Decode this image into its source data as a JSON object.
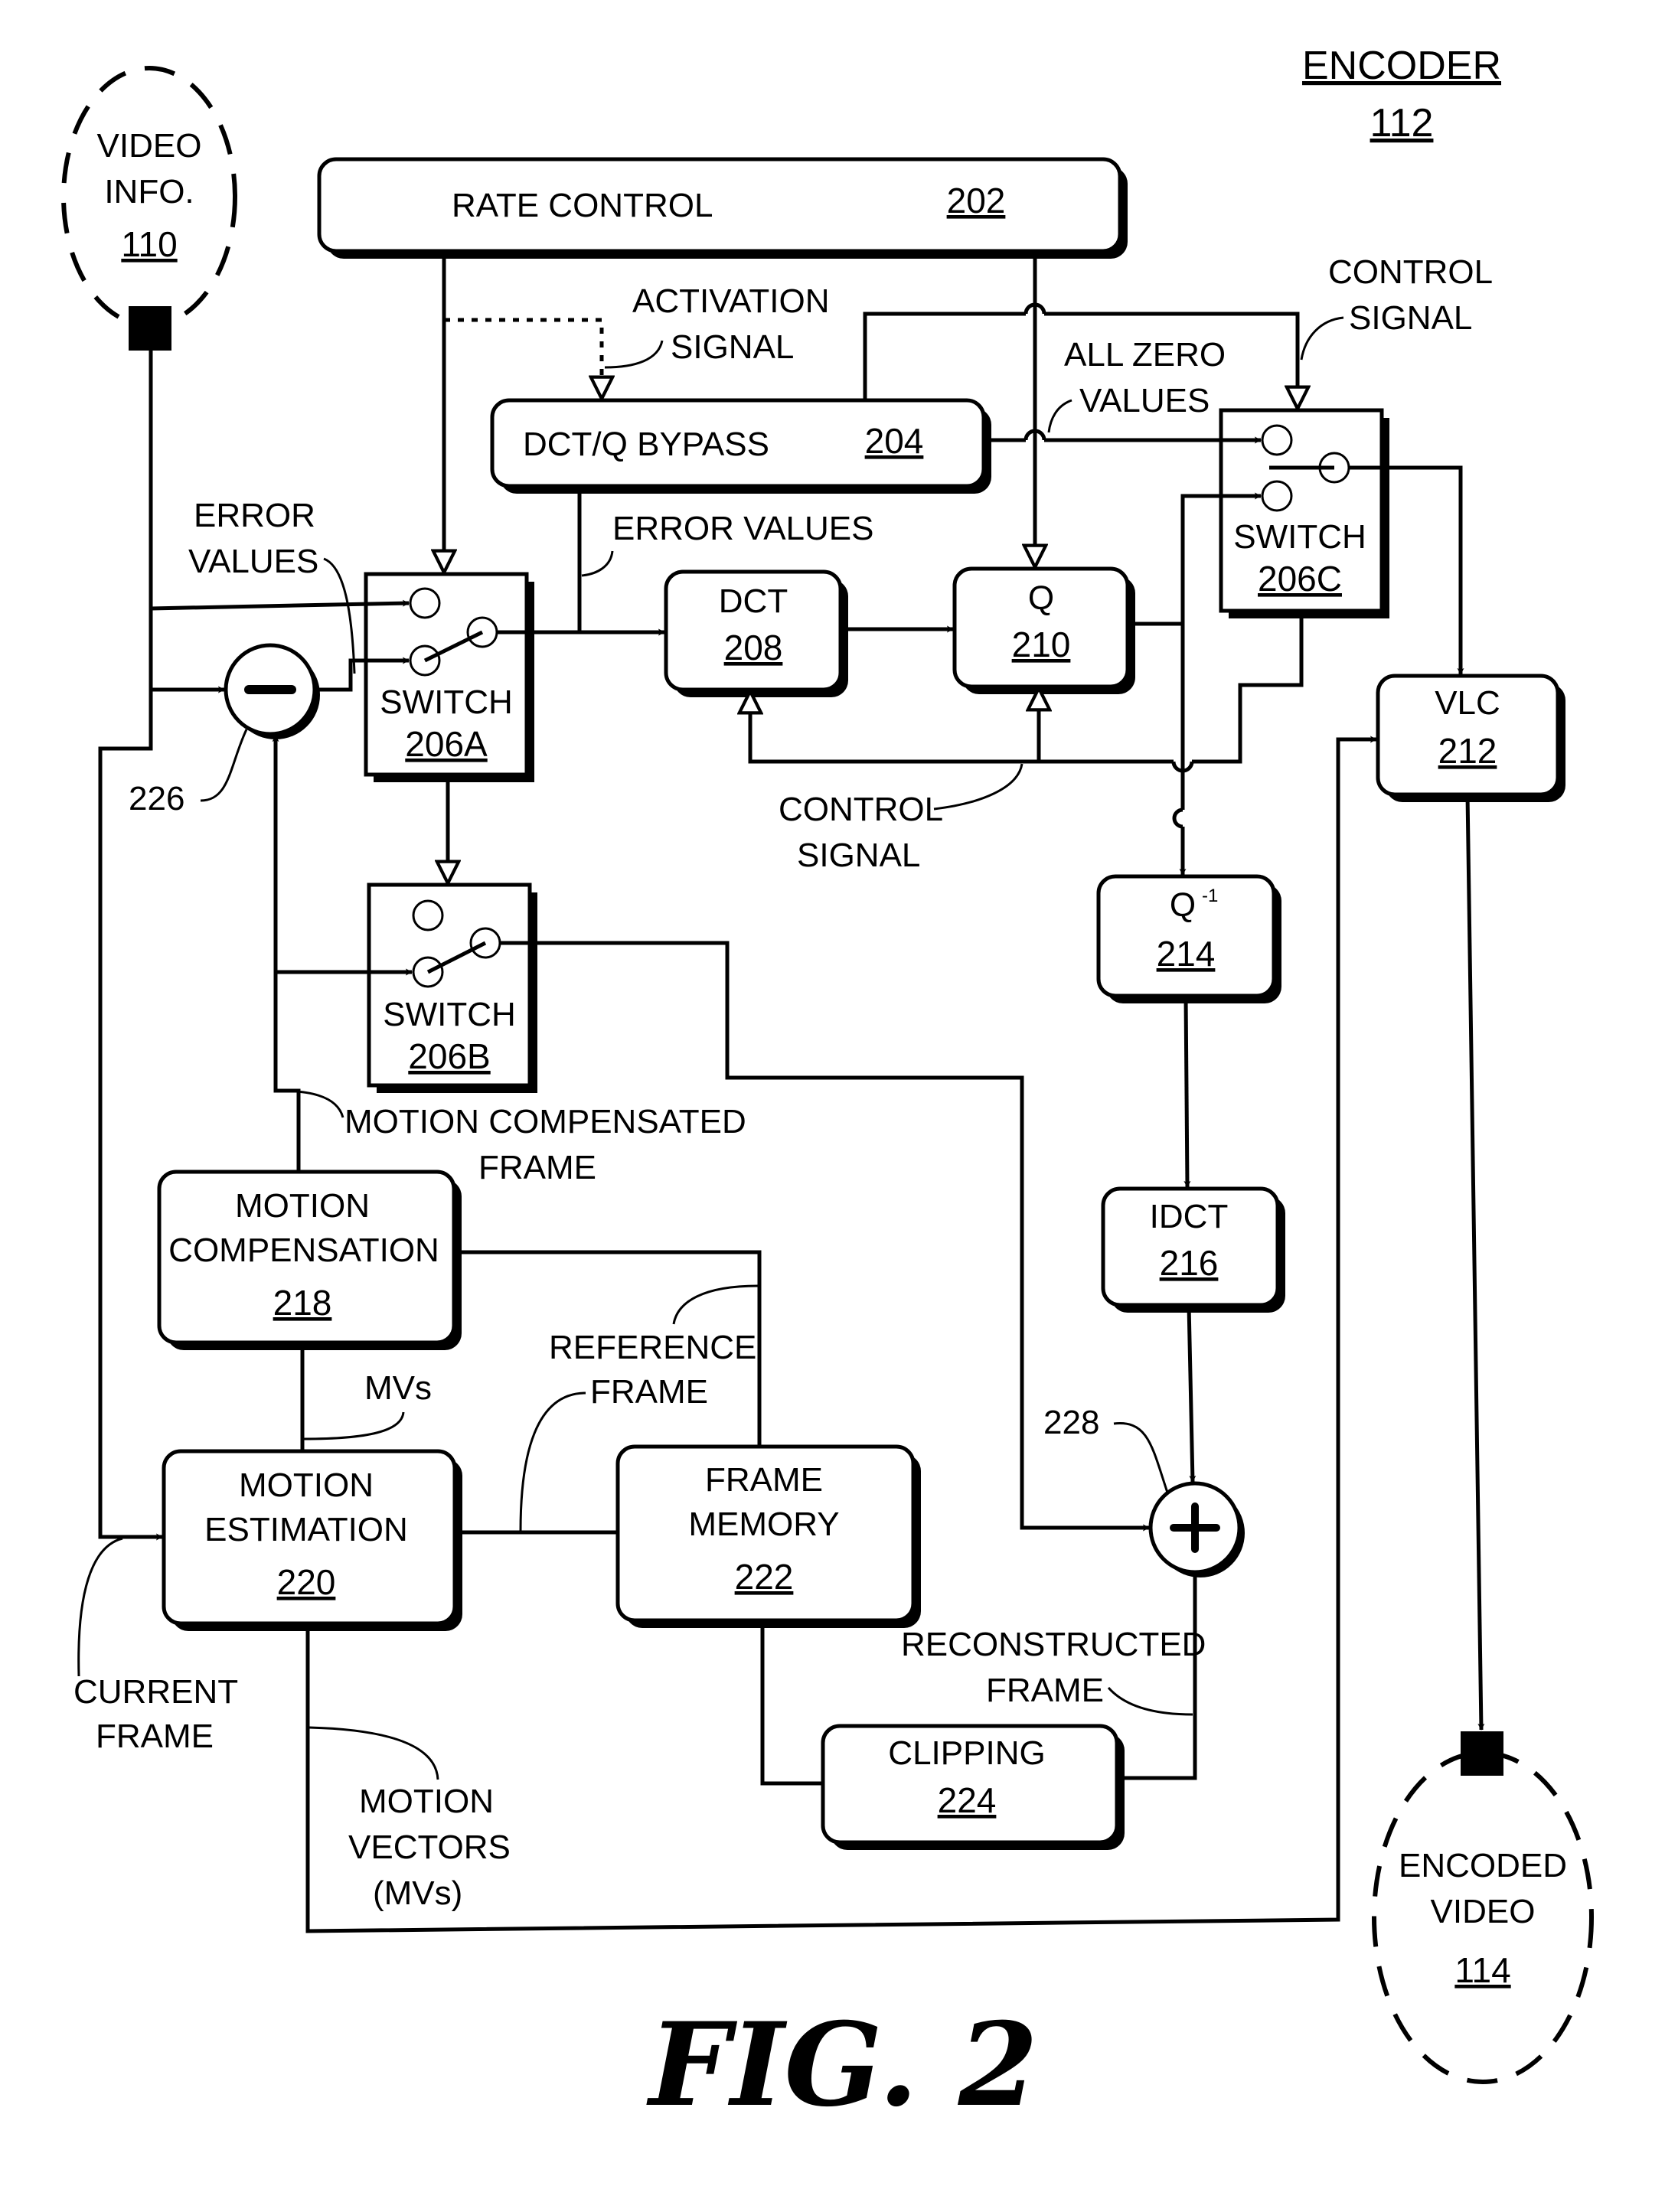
{
  "figure": {
    "title": "ENCODER",
    "title_number": "112",
    "caption": "FIG. 2"
  },
  "terminals": {
    "input": {
      "line1": "VIDEO",
      "line2": "INFO.",
      "number": "110"
    },
    "output": {
      "line1": "ENCODED",
      "line2": "VIDEO",
      "number": "114"
    }
  },
  "blocks": {
    "rate_control": {
      "label": "RATE CONTROL",
      "number": "202"
    },
    "bypass": {
      "label": "DCT/Q BYPASS",
      "number": "204"
    },
    "switch_a": {
      "label": "SWITCH",
      "number": "206A"
    },
    "switch_b": {
      "label": "SWITCH",
      "number": "206B"
    },
    "switch_c": {
      "label": "SWITCH",
      "number": "206C"
    },
    "dct": {
      "label": "DCT",
      "number": "208"
    },
    "q": {
      "label": "Q",
      "number": "210"
    },
    "vlc": {
      "label": "VLC",
      "number": "212"
    },
    "q_inv": {
      "label": "Q",
      "superscript": "-1",
      "number": "214"
    },
    "idct": {
      "label": "IDCT",
      "number": "216"
    },
    "motion_comp": {
      "line1": "MOTION",
      "line2": "COMPENSATION",
      "number": "218"
    },
    "motion_est": {
      "line1": "MOTION",
      "line2": "ESTIMATION",
      "number": "220"
    },
    "frame_memory": {
      "line1": "FRAME",
      "line2": "MEMORY",
      "number": "222"
    },
    "clipping": {
      "label": "CLIPPING",
      "number": "224"
    }
  },
  "nodes": {
    "subtractor": {
      "symbol": "−",
      "number": "226"
    },
    "adder": {
      "symbol": "+",
      "number": "228"
    }
  },
  "annotations": {
    "activation_signal": {
      "line1": "ACTIVATION",
      "line2": "SIGNAL"
    },
    "control_signal_top": {
      "line1": "CONTROL",
      "line2": "SIGNAL"
    },
    "all_zero_values": {
      "line1": "ALL ZERO",
      "line2": "VALUES"
    },
    "error_values_left": {
      "line1": "ERROR",
      "line2": "VALUES"
    },
    "error_values_mid": {
      "line1": "ERROR VALUES"
    },
    "control_signal_mid": {
      "line1": "CONTROL",
      "line2": "SIGNAL"
    },
    "motion_compensated_frame": {
      "line1": "MOTION COMPENSATED",
      "line2": "FRAME"
    },
    "mvs": {
      "line1": "MVs"
    },
    "reference_frame": {
      "line1": "REFERENCE",
      "line2": "FRAME"
    },
    "reconstructed_frame": {
      "line1": "RECONSTRUCTED",
      "line2": "FRAME"
    },
    "current_frame": {
      "line1": "CURRENT",
      "line2": "FRAME"
    },
    "motion_vectors": {
      "line1": "MOTION",
      "line2": "VECTORS",
      "line3": "(MVs)"
    }
  }
}
